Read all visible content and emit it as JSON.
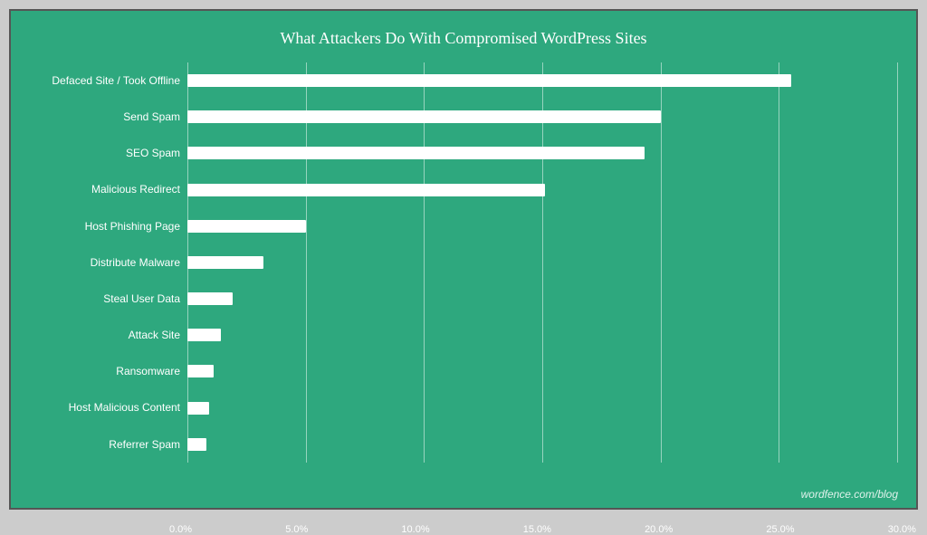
{
  "chart": {
    "title": "What Attackers Do With Compromised WordPress Sites",
    "watermark": "wordfence.com/blog",
    "bars": [
      {
        "label": "Defaced Site / Took Offline",
        "value": 25.5,
        "maxValue": 30
      },
      {
        "label": "Send Spam",
        "value": 20.0,
        "maxValue": 30
      },
      {
        "label": "SEO Spam",
        "value": 19.3,
        "maxValue": 30
      },
      {
        "label": "Malicious Redirect",
        "value": 15.1,
        "maxValue": 30
      },
      {
        "label": "Host Phishing Page",
        "value": 5.0,
        "maxValue": 30
      },
      {
        "label": "Distribute Malware",
        "value": 3.2,
        "maxValue": 30
      },
      {
        "label": "Steal User Data",
        "value": 1.9,
        "maxValue": 30
      },
      {
        "label": "Attack Site",
        "value": 1.4,
        "maxValue": 30
      },
      {
        "label": "Ransomware",
        "value": 1.1,
        "maxValue": 30
      },
      {
        "label": "Host Malicious Content",
        "value": 0.9,
        "maxValue": 30
      },
      {
        "label": "Referrer Spam",
        "value": 0.8,
        "maxValue": 30
      }
    ],
    "xLabels": [
      "0.0%",
      "5.0%",
      "10.0%",
      "15.0%",
      "20.0%",
      "25.0%",
      "30.0%"
    ],
    "gridCount": 7
  }
}
